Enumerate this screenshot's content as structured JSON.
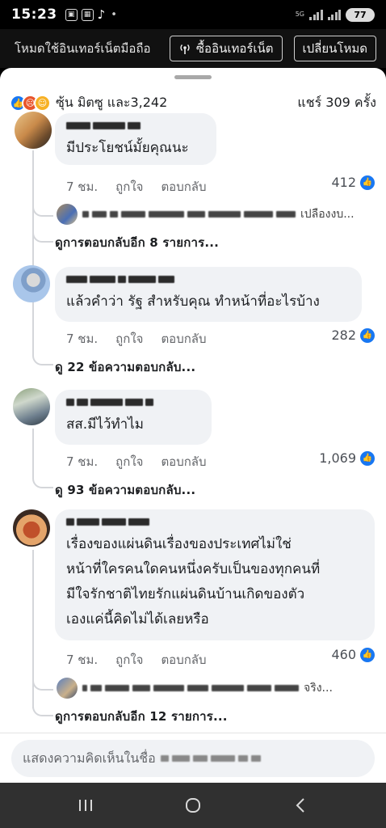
{
  "status": {
    "time": "15:23",
    "network": "5G",
    "battery": "77"
  },
  "mode_bar": {
    "text": "โหมดใช้อินเทอร์เน็ตมือถือ",
    "buy_label": "ซื้ออินเทอร์เน็ต",
    "switch_label": "เปลี่ยนโหมด"
  },
  "reactions": {
    "summary": "ซุ้น มิตซู และ3,242",
    "shares": "แชร์ 309 ครั้ง"
  },
  "comments": [
    {
      "text": "มีประโยชน์มั้ยคุณนะ",
      "time": "7 ชม.",
      "like_label": "ถูกใจ",
      "reply_label": "ตอบกลับ",
      "likes": "412",
      "reply_preview_suffix": "เปลืองงบ...",
      "more_replies": "ดูการตอบกลับอีก 8 รายการ..."
    },
    {
      "text": "แล้วคำว่า รัฐ สำหรับคุณ ทำหน้าที่อะไรบ้าง",
      "time": "7 ชม.",
      "like_label": "ถูกใจ",
      "reply_label": "ตอบกลับ",
      "likes": "282",
      "more_replies": "ดู 22 ข้อความตอบกลับ..."
    },
    {
      "text": "สส.มีไว้ทำไม",
      "time": "7 ชม.",
      "like_label": "ถูกใจ",
      "reply_label": "ตอบกลับ",
      "likes": "1,069",
      "more_replies": "ดู 93 ข้อความตอบกลับ..."
    },
    {
      "text_lines": [
        "เรื่องของแผ่นดินเรื่องของประเทศไม่ใช่",
        "หน้าที่ใครคนใดคนหนึ่งครับเป็นของทุกคนที่",
        "มีใจรักชาติไทยรักแผ่นดินบ้านเกิดของตัว",
        "เองแค่นี้คิดไม่ได้เลยหรือ"
      ],
      "time": "7 ชม.",
      "like_label": "ถูกใจ",
      "reply_label": "ตอบกลับ",
      "likes": "460",
      "reply_preview_suffix": "จริง...",
      "more_replies": "ดูการตอบกลับอีก 12 รายการ..."
    }
  ],
  "input": {
    "placeholder": "แสดงความคิดเห็นในชื่อ"
  },
  "icons": {
    "like": "thumbs-up-icon",
    "angry": "angry-face-icon",
    "haha": "laughing-face-icon"
  },
  "colors": {
    "accent": "#1877f2",
    "bubble": "#f0f2f5",
    "muted": "#65676b"
  }
}
